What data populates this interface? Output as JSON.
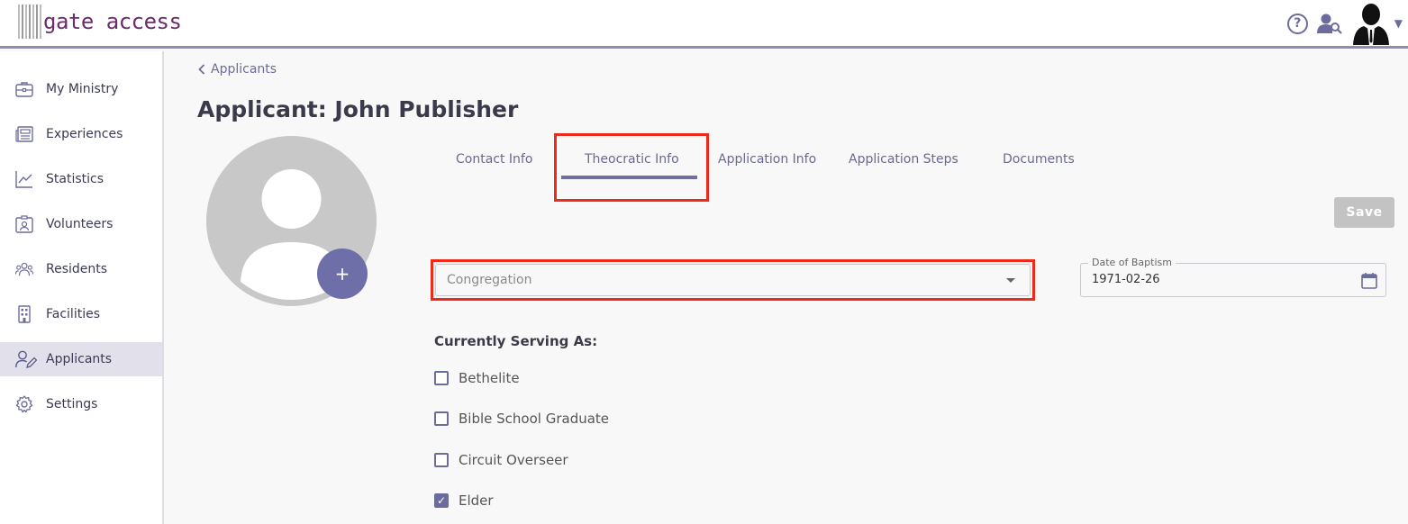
{
  "app": {
    "logo_text": "gate access"
  },
  "header": {
    "help_icon": "help-circle-icon",
    "user_search_icon": "user-search-icon",
    "profile_icon": "profile-avatar-icon"
  },
  "sidebar": {
    "items": [
      {
        "label": "My Ministry",
        "icon": "briefcase-icon"
      },
      {
        "label": "Experiences",
        "icon": "newspaper-icon"
      },
      {
        "label": "Statistics",
        "icon": "chart-line-icon"
      },
      {
        "label": "Volunteers",
        "icon": "id-badge-icon"
      },
      {
        "label": "Residents",
        "icon": "users-icon"
      },
      {
        "label": "Facilities",
        "icon": "building-icon"
      },
      {
        "label": "Applicants",
        "icon": "user-edit-icon",
        "active": true
      },
      {
        "label": "Settings",
        "icon": "gear-icon"
      }
    ]
  },
  "breadcrumb": {
    "label": "Applicants"
  },
  "page": {
    "title": "Applicant: John Publisher",
    "add_photo_label": "+"
  },
  "tabs": [
    {
      "label": "Contact Info"
    },
    {
      "label": "Theocratic Info",
      "active": true
    },
    {
      "label": "Application Info"
    },
    {
      "label": "Application Steps"
    },
    {
      "label": "Documents"
    }
  ],
  "form": {
    "save_label": "Save",
    "congregation_label": "Congregation",
    "date_label": "Date of Baptism",
    "date_value": "1971-02-26",
    "serving_label": "Currently Serving As:",
    "serving_options": [
      {
        "label": "Bethelite",
        "checked": false
      },
      {
        "label": "Bible School Graduate",
        "checked": false
      },
      {
        "label": "Circuit Overseer",
        "checked": false
      },
      {
        "label": "Elder",
        "checked": true
      }
    ]
  },
  "colors": {
    "accent": "#6e6ea8",
    "highlight": "#ee2a1a",
    "logo": "#6b2d6b"
  }
}
